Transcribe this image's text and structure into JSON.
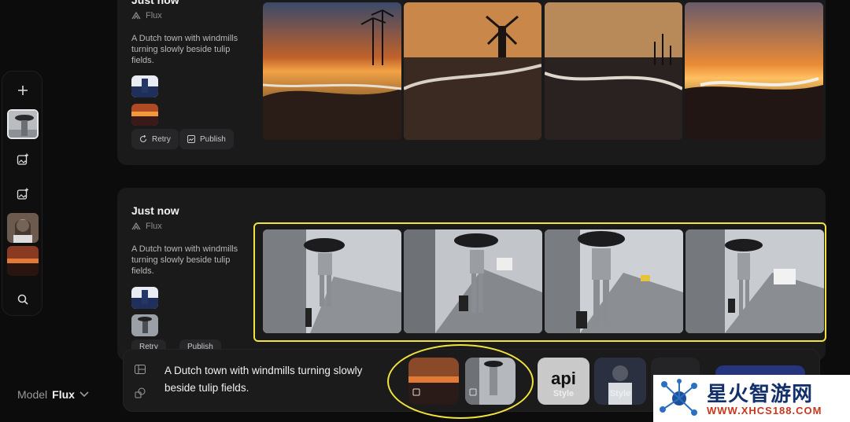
{
  "sidebar": {
    "add_icon": "plus-icon",
    "icons": [
      "image-plus-icon",
      "image-plus-icon",
      "search-icon"
    ]
  },
  "model": {
    "label": "Model",
    "value": "Flux"
  },
  "feed": [
    {
      "title": "Just now",
      "model": "Flux",
      "prompt": "A Dutch town with windmills turning slowly beside tulip fields.",
      "actions": {
        "retry": "Retry",
        "publish": "Publish"
      }
    },
    {
      "title": "Just now",
      "model": "Flux",
      "prompt": "A Dutch town with windmills turning slowly beside tulip fields.",
      "actions": {
        "retry": "Retry",
        "publish": "Publish"
      }
    }
  ],
  "composer": {
    "prompt": "A Dutch town with windmills turning slowly beside tulip fields.",
    "style_label": "Style",
    "api_text": "api"
  },
  "watermark": {
    "title": "星火智游网",
    "url": "WWW.XHCS188.COM"
  },
  "colors": {
    "highlight": "#f2e23c",
    "card": "#1a1a1b",
    "background": "#0c0c0d"
  }
}
